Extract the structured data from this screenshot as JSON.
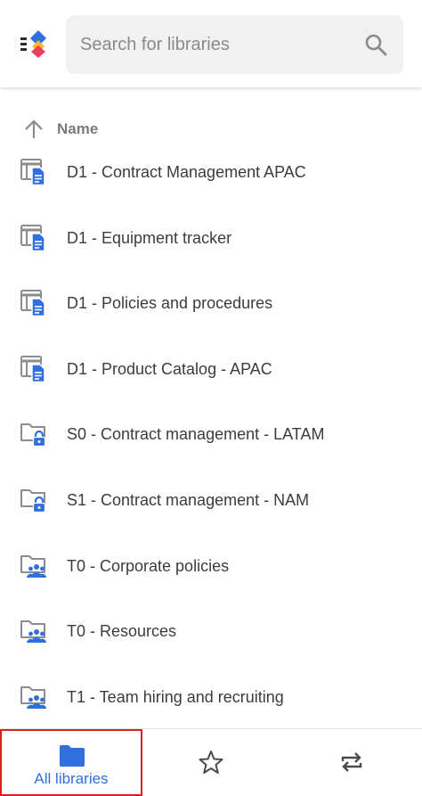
{
  "search": {
    "placeholder": "Search for libraries"
  },
  "sort": {
    "label": "Name"
  },
  "libraries": [
    {
      "name": "D1 - Contract Management APAC",
      "icon": "list-document-icon"
    },
    {
      "name": "D1 - Equipment tracker",
      "icon": "list-document-icon"
    },
    {
      "name": "D1 - Policies and procedures",
      "icon": "list-document-icon"
    },
    {
      "name": "D1 - Product Catalog - APAC",
      "icon": "list-document-icon"
    },
    {
      "name": "S0 - Contract management - LATAM",
      "icon": "folder-lock-icon"
    },
    {
      "name": "S1 - Contract management - NAM",
      "icon": "folder-lock-icon"
    },
    {
      "name": "T0 - Corporate policies",
      "icon": "folder-team-icon"
    },
    {
      "name": "T0 - Resources",
      "icon": "folder-team-icon"
    },
    {
      "name": "T1 - Team hiring and recruiting",
      "icon": "folder-team-icon"
    }
  ],
  "bottom_nav": {
    "all_libraries_label": "All libraries"
  },
  "colors": {
    "accent": "#2f6fde",
    "icon_gray": "#8c8c8c",
    "selection_outline": "#e02020"
  }
}
